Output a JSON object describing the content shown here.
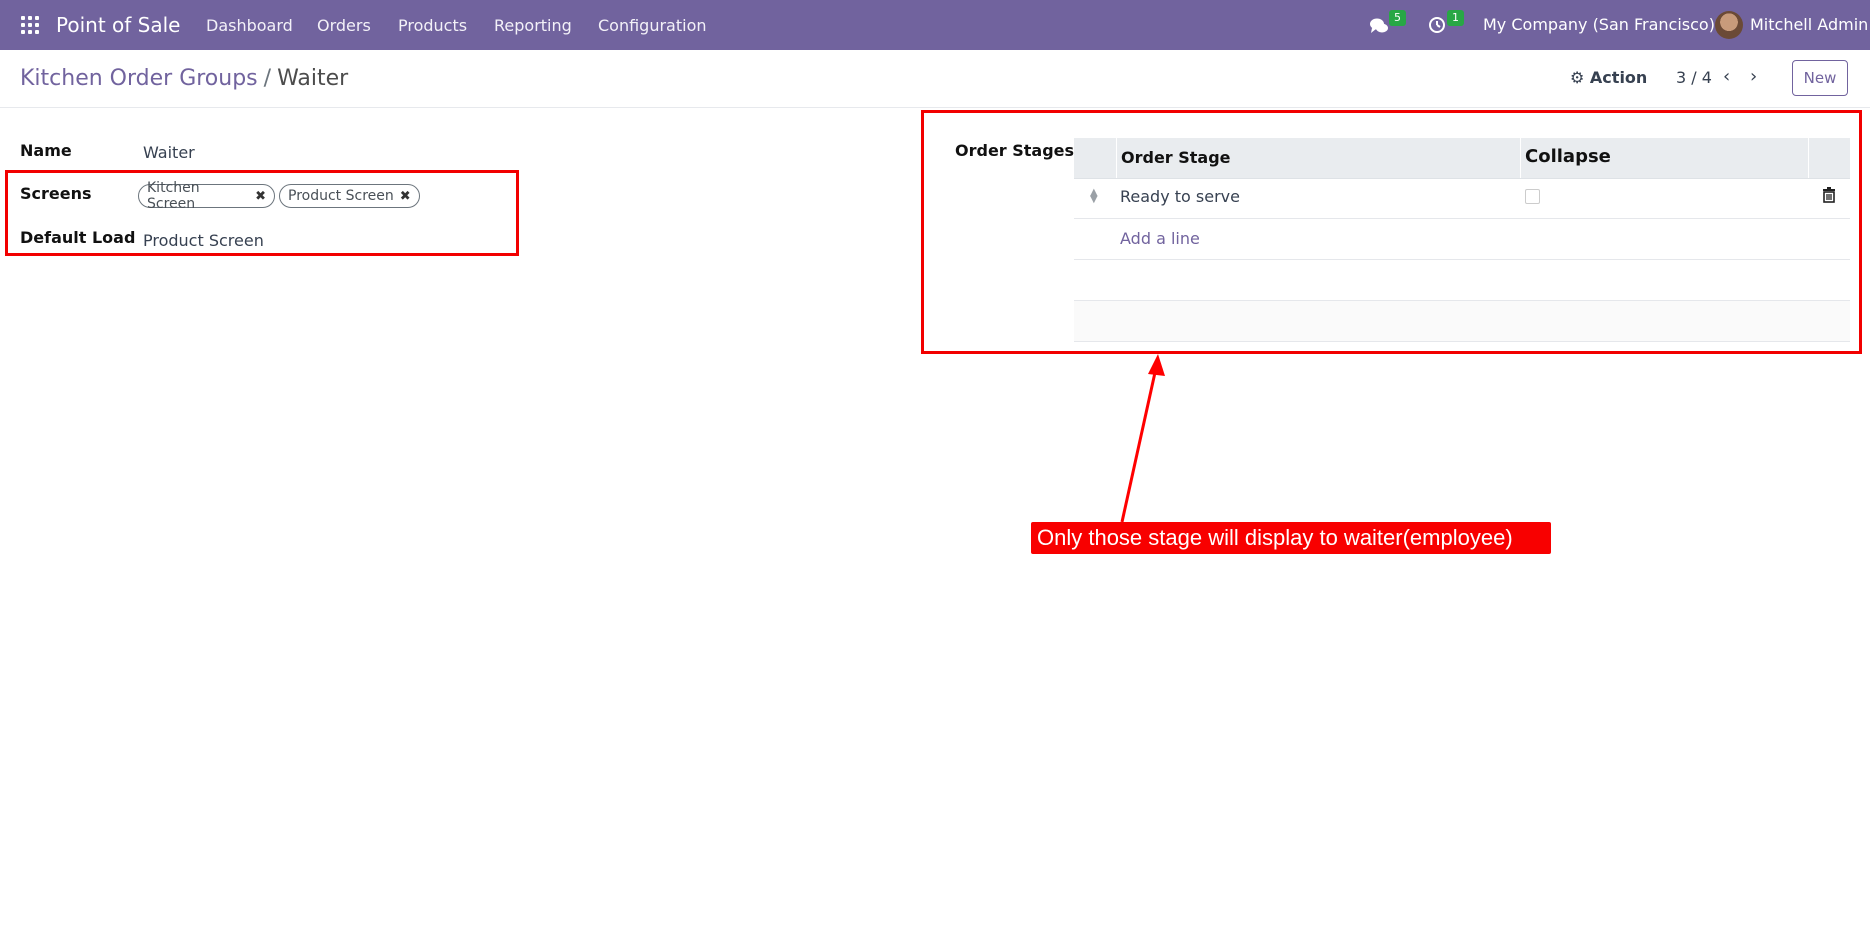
{
  "navbar": {
    "brand": "Point of Sale",
    "menu": [
      "Dashboard",
      "Orders",
      "Products",
      "Reporting",
      "Configuration"
    ],
    "messages_count": "5",
    "activities_count": "1",
    "company": "My Company (San Francisco)",
    "user": "Mitchell Admin"
  },
  "control": {
    "breadcrumb_parent": "Kitchen Order Groups",
    "breadcrumb_sep": "/",
    "breadcrumb_current": "Waiter",
    "action_label": "Action",
    "pager": "3 / 4",
    "new_label": "New"
  },
  "form": {
    "name_label": "Name",
    "name_value": "Waiter",
    "screens_label": "Screens",
    "screens": [
      "Kitchen Screen",
      "Product Screen"
    ],
    "default_load_label": "Default Load",
    "default_load_value": "Product Screen",
    "order_stages_label": "Order Stages"
  },
  "table": {
    "headers": [
      "Order Stage",
      "Collapse"
    ],
    "rows": [
      {
        "stage": "Ready to serve"
      }
    ],
    "add_line": "Add a line"
  },
  "annotation": "Only those stage will display to waiter(employee)",
  "colors": {
    "brand": "#71639e",
    "annotation": "#f20000",
    "badge": "#28a745"
  }
}
